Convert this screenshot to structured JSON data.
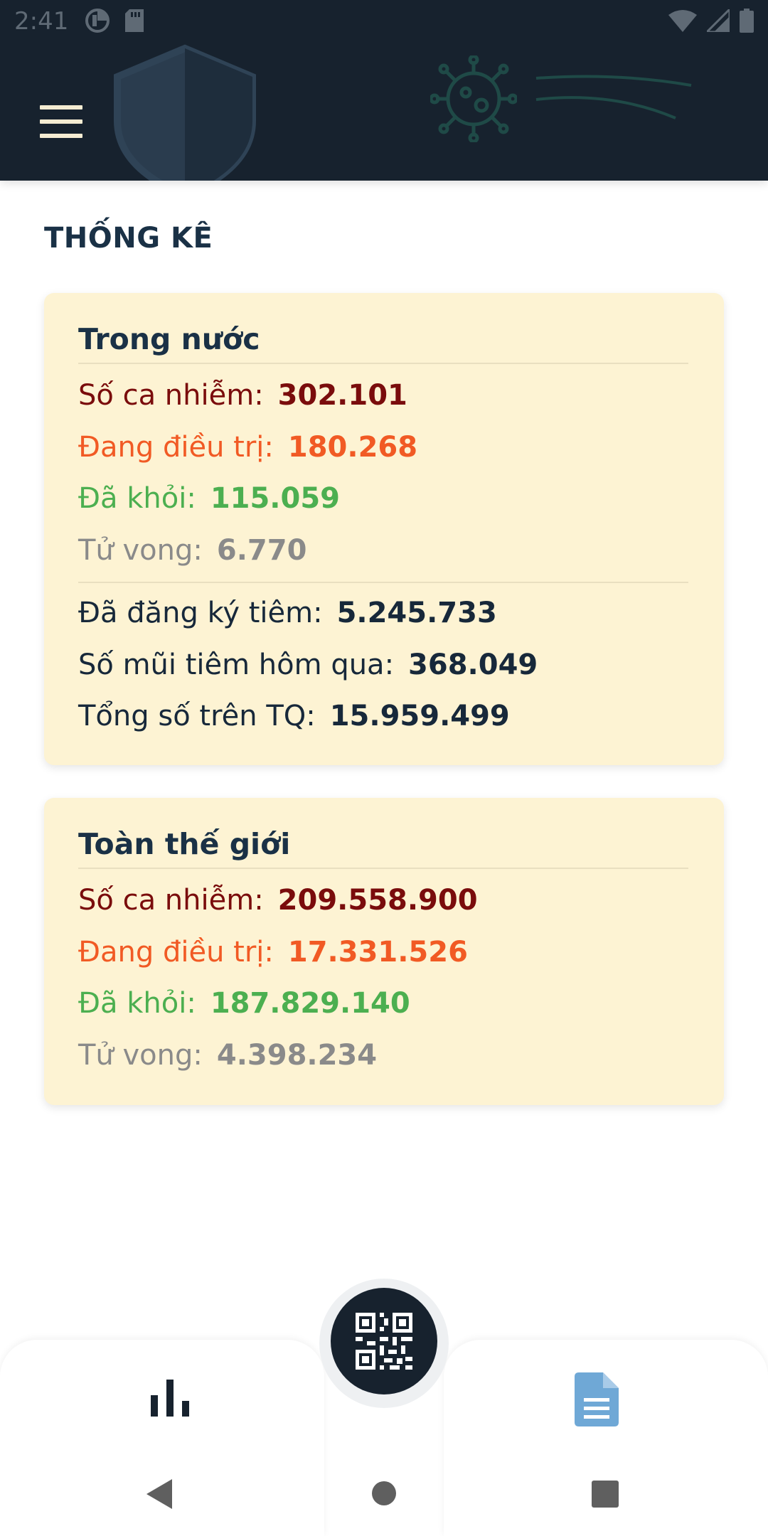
{
  "status_bar": {
    "time": "2:41",
    "left_icons": [
      "data-saver-icon",
      "sd-card-icon"
    ],
    "right_icons": [
      "wifi-icon",
      "signal-icon",
      "battery-icon"
    ]
  },
  "header": {
    "menu_icon": "hamburger-menu-icon",
    "decorations": [
      "shield-icon",
      "virus-icon"
    ]
  },
  "section_title": "THỐNG KÊ",
  "domestic": {
    "title": "Trong nước",
    "infected_label": "Số ca nhiễm:",
    "infected_value": "302.101",
    "treating_label": "Đang điều trị:",
    "treating_value": "180.268",
    "recovered_label": "Đã khỏi:",
    "recovered_value": "115.059",
    "deaths_label": "Tử vong:",
    "deaths_value": "6.770",
    "registered_label": "Đã đăng ký tiêm:",
    "registered_value": "5.245.733",
    "doses_yesterday_label": "Số mũi tiêm hôm qua:",
    "doses_yesterday_value": "368.049",
    "total_label": "Tổng số trên TQ:",
    "total_value": "15.959.499"
  },
  "world": {
    "title": "Toàn thế giới",
    "infected_label": "Số ca nhiễm:",
    "infected_value": "209.558.900",
    "treating_label": "Đang điều trị:",
    "treating_value": "17.331.526",
    "recovered_label": "Đã khỏi:",
    "recovered_value": "187.829.140",
    "deaths_label": "Tử vong:",
    "deaths_value": "4.398.234"
  },
  "colors": {
    "header_bg": "#17222e",
    "card_bg": "#fdf3d3",
    "title": "#1a3146",
    "infected": "#7a0c0c",
    "treating": "#f15a24",
    "recovered": "#4caf50",
    "deaths": "#8a8a8a",
    "doc_icon": "#6fa8d6"
  },
  "bottom_nav": {
    "left_icon": "bar-chart-icon",
    "center_icon": "qr-code-icon",
    "right_icon": "document-icon"
  },
  "system_nav": [
    "back-icon",
    "home-icon",
    "recents-icon"
  ]
}
